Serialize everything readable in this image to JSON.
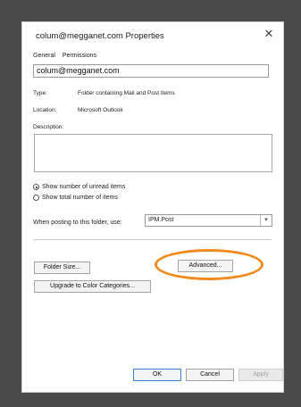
{
  "window": {
    "title": "colum@megganet.com Properties",
    "close_glyph": "✕"
  },
  "tabs": [
    "General",
    "Permissions"
  ],
  "name_field": "colum@megganet.com",
  "info": {
    "type_label": "Type:",
    "type_value": "Folder containing Mail and Post Items",
    "location_label": "Location:",
    "location_value": "Microsoft Outlook",
    "description_label": "Description:"
  },
  "options": {
    "unread_label": "Show number of unread items",
    "total_label": "Show total number of items",
    "selected": "unread"
  },
  "posting": {
    "label": "When posting to this folder, use:",
    "value": "IPM.Post"
  },
  "buttons": {
    "folder_size": "Folder Size...",
    "advanced": "Advanced...",
    "upgrade": "Upgrade to Color Categories...",
    "ok": "OK",
    "cancel": "Cancel",
    "apply": "Apply"
  },
  "colors": {
    "highlight_ring": "#f08a1c",
    "primary_border": "#3d7fd8"
  }
}
